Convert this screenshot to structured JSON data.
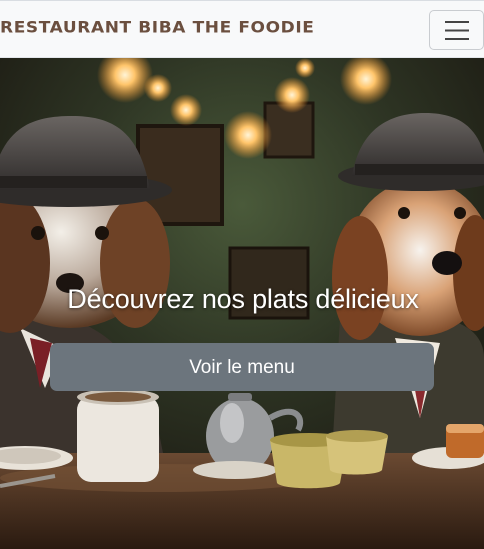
{
  "navbar": {
    "brand": "RESTAURANT BIBA THE FOODIE",
    "toggler_icon": "hamburger-icon",
    "brand_color": "#6b4f3f"
  },
  "hero": {
    "caption_title": "Découvrez nos plats délicieux",
    "button_label": "Voir le menu",
    "button_color": "#6c757d"
  }
}
